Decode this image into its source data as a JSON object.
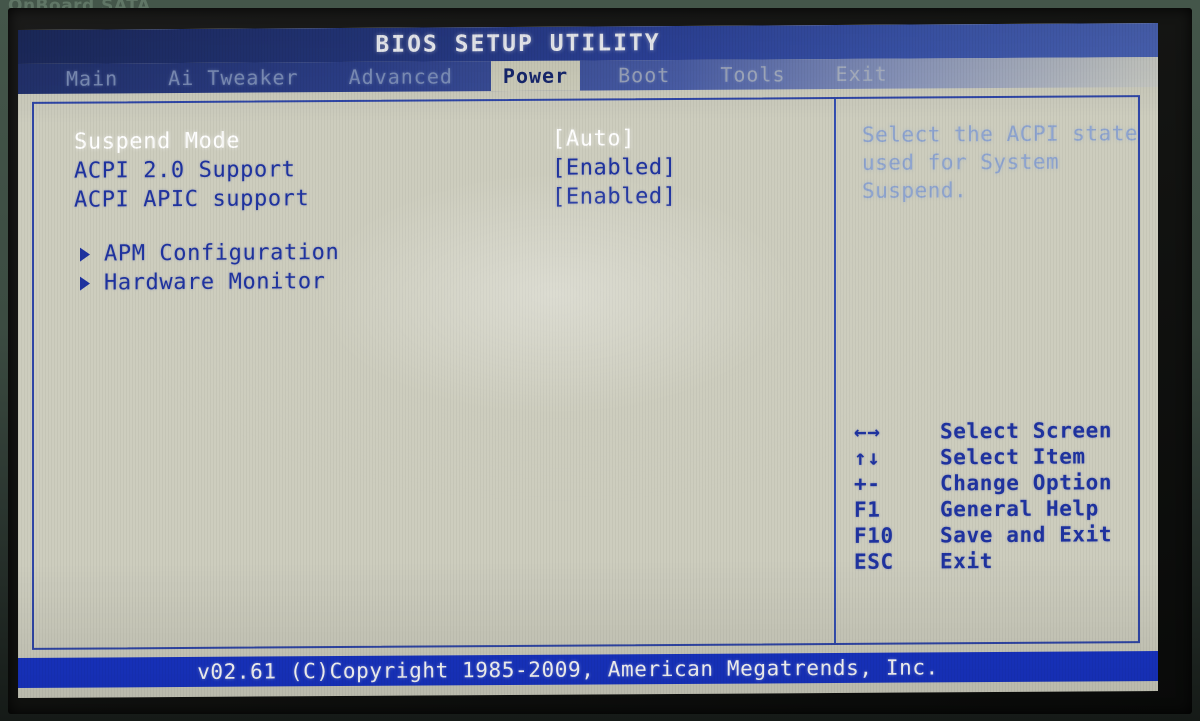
{
  "photo": {
    "edge_text": "OnBoard SATA"
  },
  "title": "BIOS SETUP UTILITY",
  "menu": {
    "tabs": [
      {
        "label": "Main",
        "selected": false
      },
      {
        "label": "Ai Tweaker",
        "selected": false
      },
      {
        "label": "Advanced",
        "selected": false
      },
      {
        "label": "Power",
        "selected": true
      },
      {
        "label": "Boot",
        "selected": false
      },
      {
        "label": "Tools",
        "selected": false
      },
      {
        "label": "Exit",
        "selected": false
      }
    ]
  },
  "settings": [
    {
      "label": "Suspend Mode",
      "value": "[Auto]",
      "selected": true
    },
    {
      "label": "ACPI 2.0 Support",
      "value": "[Enabled]",
      "selected": false
    },
    {
      "label": "ACPI APIC support",
      "value": "[Enabled]",
      "selected": false
    }
  ],
  "submenus": [
    {
      "label": "APM Configuration"
    },
    {
      "label": "Hardware Monitor"
    }
  ],
  "help": {
    "lines": [
      "Select the ACPI state",
      "used for System",
      "Suspend."
    ]
  },
  "keys": [
    {
      "key": "←→",
      "desc": "Select Screen"
    },
    {
      "key": "↑↓",
      "desc": "Select Item"
    },
    {
      "key": "+-",
      "desc": "Change Option"
    },
    {
      "key": "F1",
      "desc": "General Help"
    },
    {
      "key": "F10",
      "desc": "Save and Exit"
    },
    {
      "key": "ESC",
      "desc": "Exit"
    }
  ],
  "footer": {
    "text": "v02.61 (C)Copyright 1985-2009, American Megatrends, Inc."
  },
  "colors": {
    "screen_bg": "#cdcdbe",
    "title_blue": "#2c429b",
    "text_blue": "#1f33a0",
    "selected_white": "#ffffff",
    "footer_blue": "#1733c4",
    "help_blue": "#8ea4cf",
    "frame_border": "#2f46a8"
  }
}
